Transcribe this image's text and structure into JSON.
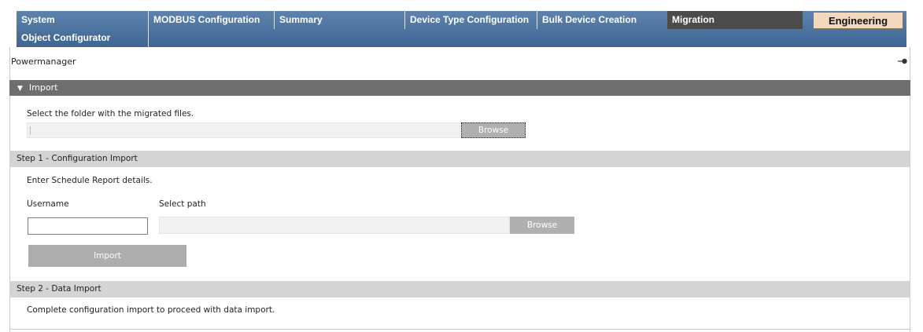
{
  "tabs": {
    "system": "System",
    "modbus": "MODBUS Configuration",
    "summary": "Summary",
    "device_type": "Device Type Configuration",
    "bulk_device": "Bulk Device Creation",
    "migration": "Migration",
    "engineering": "Engineering",
    "object_configurator": "Object Configurator"
  },
  "header": {
    "title": "Powermanager",
    "pin_icon": "pin-icon"
  },
  "import_section": {
    "title": "Import",
    "folder_prompt": "Select the folder with the migrated files.",
    "folder_value": "",
    "browse_label": "Browse"
  },
  "step1": {
    "title": "Step 1 - Configuration Import",
    "instructions": "Enter Schedule Report details.",
    "username_label": "Username",
    "username_value": "",
    "path_label": "Select path",
    "path_value": "",
    "browse_label": "Browse",
    "import_label": "Import"
  },
  "step2": {
    "title": "Step 2 - Data Import",
    "message": "Complete configuration import to proceed with data import."
  },
  "colors": {
    "tab_bar": "#4a6f9b",
    "active_tab": "#4b4b4b",
    "engineering_tab": "#f2d9bd",
    "section_header": "#6e6e6e",
    "step_bar": "#d4d4d4",
    "disabled_button": "#b0b0b0"
  }
}
